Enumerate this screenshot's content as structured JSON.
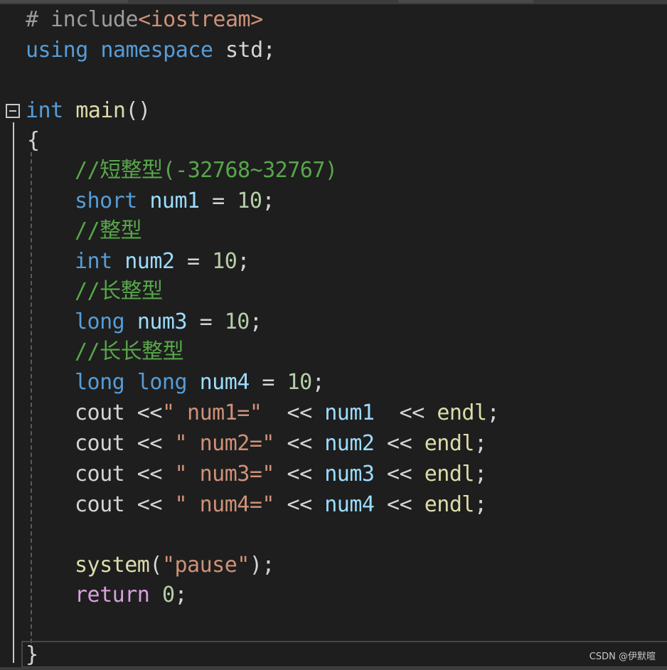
{
  "code": {
    "l1": [
      "# include",
      "<iostream>"
    ],
    "l2": [
      "using",
      " ",
      "namespace",
      " std;"
    ],
    "l4": [
      "int",
      " ",
      "main",
      "()"
    ],
    "l5": [
      "{"
    ],
    "l6": [
      "//短整型(-32768~32767)"
    ],
    "l7": [
      "short",
      " ",
      "num1",
      " = ",
      "10",
      ";"
    ],
    "l8": [
      "//整型"
    ],
    "l9": [
      "int",
      " ",
      "num2",
      " = ",
      "10",
      ";"
    ],
    "l10": [
      "//长整型"
    ],
    "l11": [
      "long",
      " ",
      "num3",
      " = ",
      "10",
      ";"
    ],
    "l12": [
      "//长长整型"
    ],
    "l13": [
      "long",
      " ",
      "long",
      " ",
      "num4",
      " = ",
      "10",
      ";"
    ],
    "l14": [
      "cout",
      " <<",
      "\" num1=\"",
      "  << ",
      "num1",
      "  << ",
      "endl",
      ";"
    ],
    "l15": [
      "cout",
      " << ",
      "\" num2=\"",
      " << ",
      "num2",
      " << ",
      "endl",
      ";"
    ],
    "l16": [
      "cout",
      " << ",
      "\" num3=\"",
      " << ",
      "num3",
      " << ",
      "endl",
      ";"
    ],
    "l17": [
      "cout",
      " << ",
      "\" num4=\"",
      " << ",
      "num4",
      " << ",
      "endl",
      ";"
    ],
    "l19": [
      "system",
      "(",
      "\"pause\"",
      ");"
    ],
    "l20": [
      "return",
      " ",
      "0",
      ";"
    ],
    "l22": [
      "}"
    ]
  },
  "watermark": "CSDN @伊默暄",
  "colors": {
    "background": "#1e1e1e",
    "keyword": "#569cd6",
    "function": "#dcdcaa",
    "variable": "#9cdcfe",
    "number": "#b5cea8",
    "string": "#ce9178",
    "comment": "#57a64a",
    "control_keyword": "#d8a0df",
    "plain": "#d4d4d4"
  },
  "icons": {
    "fold": "collapse-minus-icon"
  }
}
